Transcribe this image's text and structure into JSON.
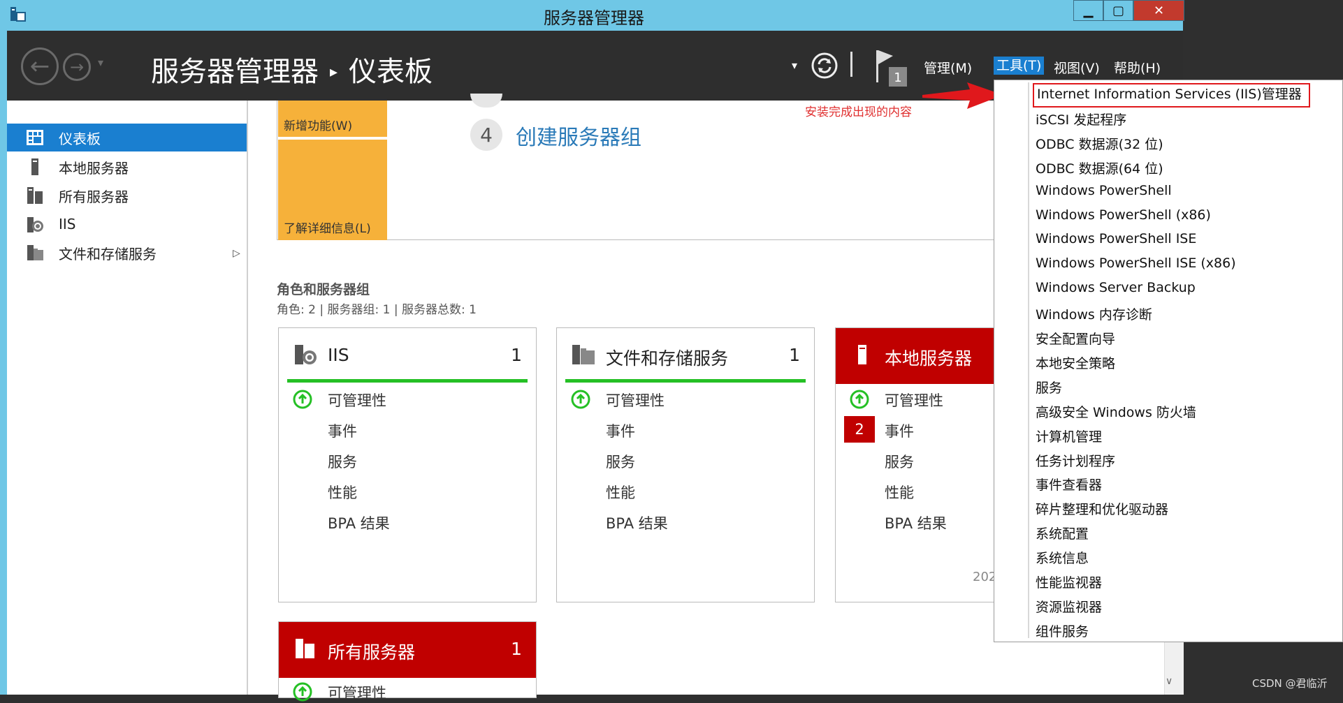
{
  "window": {
    "title": "服务器管理器",
    "controls": {
      "minimize": "▁",
      "maximize": "▢",
      "close": "✕"
    }
  },
  "header": {
    "breadcrumb_app": "服务器管理器",
    "breadcrumb_sep": "▸",
    "breadcrumb_page": "仪表板",
    "notification_count": "1",
    "menus": {
      "manage": "管理(M)",
      "tools": "工具(T)",
      "view": "视图(V)",
      "help": "帮助(H)"
    }
  },
  "sidebar": {
    "items": [
      {
        "label": "仪表板",
        "icon": "dashboard-icon",
        "active": true
      },
      {
        "label": "本地服务器",
        "icon": "server-icon"
      },
      {
        "label": "所有服务器",
        "icon": "servers-icon"
      },
      {
        "label": "IIS",
        "icon": "iis-icon"
      },
      {
        "label": "文件和存储服务",
        "icon": "storage-icon"
      }
    ]
  },
  "quickstart": {
    "new_features": "新增功能(W)",
    "learn_more": "了解详细信息(L)",
    "step_number": "4",
    "step_text": "创建服务器组"
  },
  "annotation": "安装完成出现的内容",
  "roles": {
    "title": "角色和服务器组",
    "subtitle": "角色: 2 | 服务器组: 1 | 服务器总数: 1",
    "rows": [
      "可管理性",
      "事件",
      "服务",
      "性能",
      "BPA 结果"
    ],
    "tiles": [
      {
        "name": "IIS",
        "count": "1"
      },
      {
        "name": "文件和存储服务",
        "count": "1"
      },
      {
        "name": "本地服务器",
        "event_badge": "2",
        "timestamp": "202"
      },
      {
        "name": "所有服务器",
        "count": "1",
        "partial_row": "可管理性"
      }
    ]
  },
  "tools_menu": {
    "items": [
      "Internet Information Services (IIS)管理器",
      "iSCSI 发起程序",
      "ODBC 数据源(32 位)",
      "ODBC 数据源(64 位)",
      "Windows PowerShell",
      "Windows PowerShell (x86)",
      "Windows PowerShell ISE",
      "Windows PowerShell ISE (x86)",
      "Windows Server Backup",
      "Windows 内存诊断",
      "安全配置向导",
      "本地安全策略",
      "服务",
      "高级安全 Windows 防火墙",
      "计算机管理",
      "任务计划程序",
      "事件查看器",
      "碎片整理和优化驱动器",
      "系统配置",
      "系统信息",
      "性能监视器",
      "资源监视器",
      "组件服务"
    ],
    "highlighted": "Internet Information Services (IIS)管理器"
  },
  "watermark": "CSDN @君临沂",
  "colors": {
    "accent": "#1a7fd0",
    "titlebar": "#6fc7e6",
    "header": "#2e2e2e",
    "orange": "#f6b13a",
    "red_tile": "#c00000",
    "green_status": "#25c025"
  }
}
